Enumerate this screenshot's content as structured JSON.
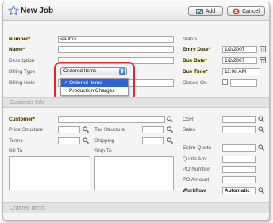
{
  "window": {
    "title": "New Job"
  },
  "toolbar": {
    "add_label": "Add",
    "cancel_label": "Cancel"
  },
  "job": {
    "number_label": "Number*",
    "number_value": "<auto>",
    "name_label": "Name*",
    "name_value": "",
    "description_label": "Description",
    "billing_type_label": "Billing Type",
    "billing_type_value": "Ordered Items",
    "billing_options": [
      "Ordered Items",
      "Production Charges"
    ],
    "billing_note_label": "Billing Note"
  },
  "status": {
    "heading": "Status",
    "entry_date_label": "Entry Date*",
    "entry_date_value": "1/2/2007",
    "due_date_label": "Due Date*",
    "due_date_value": "1/2/2007",
    "due_time_label": "Due Time*",
    "due_time_value": "11:08 AM",
    "closed_on_label": "Closed On"
  },
  "customer_info": {
    "section_title": "Customer Info",
    "customer_label": "Customer*",
    "price_structure_label": "Price Structure",
    "tax_structure_label": "Tax Structure",
    "terms_label": "Terms",
    "shipping_label": "Shipping",
    "bill_to_label": "Bill To",
    "ship_to_label": "Ship To",
    "csr_label": "CSR",
    "sales_label": "Sales",
    "estim_quote_label": "Estim-Quote",
    "quote_amt_label": "Quote Amt",
    "po_number_label": "PO Number",
    "po_amount_label": "PO Amount",
    "workflow_label": "Workflow",
    "workflow_value": "Automatic"
  },
  "ordered_items": {
    "section_title": "Ordered Items"
  },
  "colors": {
    "required_bg": "#fbf7c9",
    "highlight": "#e2262b",
    "selection": "#2c64d6"
  },
  "icons": [
    "star-icon",
    "add-icon",
    "cancel-icon",
    "magnifier-icon",
    "calendar-icon"
  ]
}
